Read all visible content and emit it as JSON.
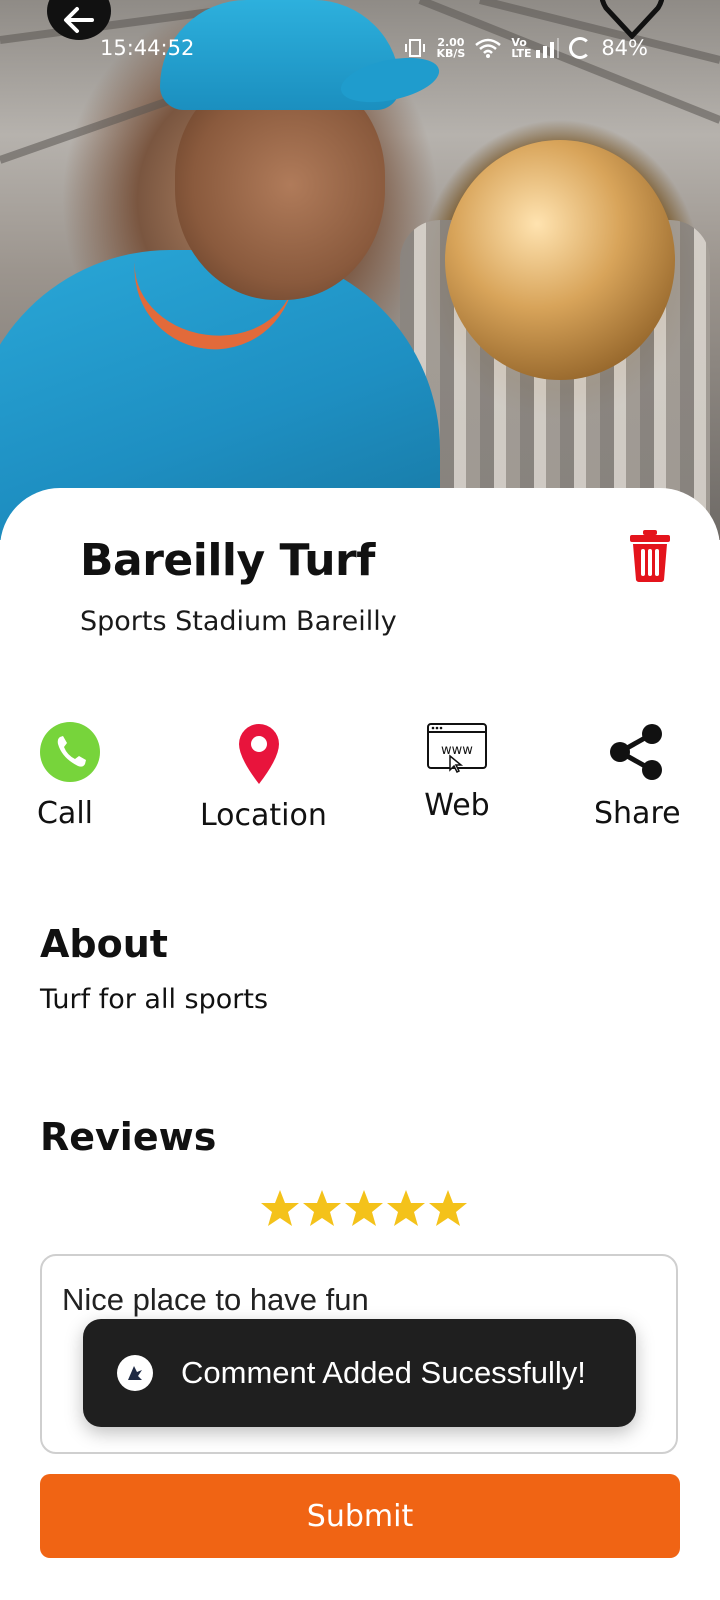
{
  "status_bar": {
    "time": "15:44:52",
    "net_speed_top": "2.00",
    "net_speed_bottom": "KB/S",
    "volte": "Vo LTE",
    "battery": "84%"
  },
  "venue": {
    "name": "Bareilly Turf",
    "subtitle": "Sports Stadium Bareilly"
  },
  "actions": [
    {
      "label": "Call",
      "icon": "phone-icon"
    },
    {
      "label": "Location",
      "icon": "map-pin-icon"
    },
    {
      "label": "Web",
      "icon": "www-icon"
    },
    {
      "label": "Share",
      "icon": "share-icon"
    }
  ],
  "about": {
    "heading": "About",
    "text": "Turf for all sports"
  },
  "reviews": {
    "heading": "Reviews",
    "rating": 5,
    "rating_max": 5,
    "comment_value": "Nice place to have fun",
    "submit_label": "Submit"
  },
  "toast": {
    "message": "Comment Added Sucessfully!"
  },
  "colors": {
    "accent": "#f06414",
    "call_green": "#77d43b",
    "pin_red": "#e8143c",
    "trash_red": "#e4141c",
    "star_yellow": "#f4c21a"
  }
}
